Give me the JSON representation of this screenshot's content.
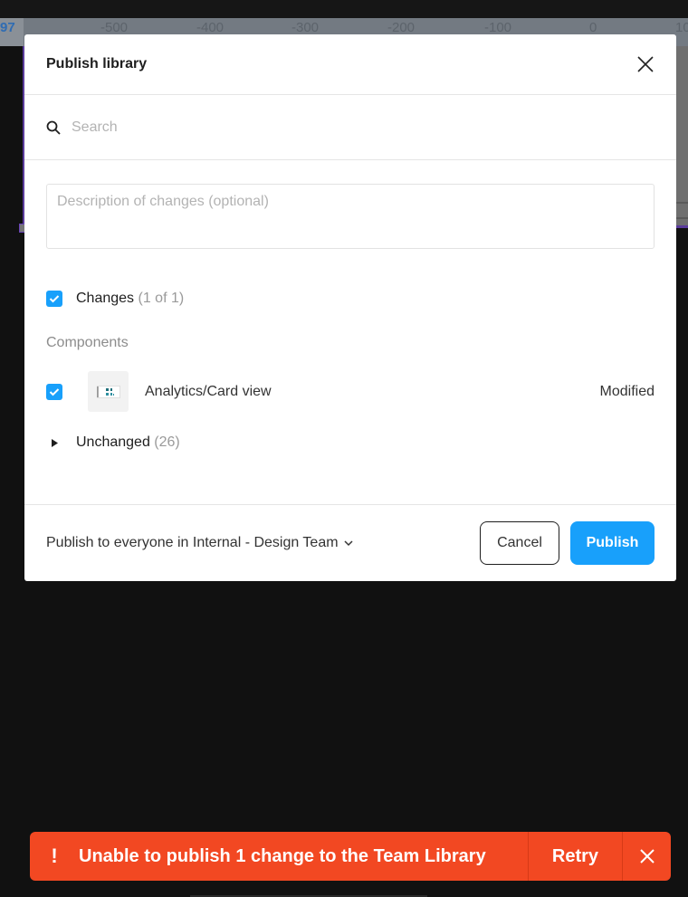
{
  "canvas": {
    "ruler_corner": "97",
    "ruler_ticks": [
      "-500",
      "-400",
      "-300",
      "-200",
      "-100",
      "0",
      "10"
    ]
  },
  "modal": {
    "title": "Publish library",
    "close_icon": "close-icon",
    "search": {
      "placeholder": "Search",
      "value": "",
      "icon": "search-icon"
    },
    "description": {
      "placeholder": "Description of changes (optional)",
      "value": ""
    },
    "changes": {
      "checked": true,
      "label": "Changes",
      "count": "(1 of 1)"
    },
    "section_label": "Components",
    "components": [
      {
        "checked": true,
        "name": "Analytics/Card view",
        "status": "Modified",
        "thumbnail": "component-thumbnail"
      }
    ],
    "unchanged": {
      "label": "Unchanged",
      "count": "(26)",
      "expanded": false
    },
    "footer": {
      "scope_label": "Publish to everyone in Internal - Design Team",
      "cancel_label": "Cancel",
      "publish_label": "Publish"
    }
  },
  "toast": {
    "icon": "!",
    "message": "Unable to publish 1 change to the Team Library",
    "retry_label": "Retry",
    "color": "#f24822"
  },
  "colors": {
    "accent": "#18a0fb",
    "error": "#f24822"
  }
}
